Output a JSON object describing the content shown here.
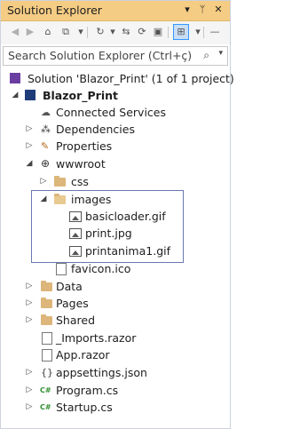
{
  "window": {
    "title": "Solution Explorer",
    "title_icons": [
      "dropdown-arrow-icon",
      "pin-icon",
      "close-icon"
    ]
  },
  "toolbar": {
    "buttons": [
      "back-icon",
      "forward-icon",
      "home-icon",
      "vs-icon",
      "history-icon",
      "sync-icon",
      "refresh-icon",
      "collapse-all-icon",
      "show-all-files-icon",
      "properties-icon",
      "preview-icon"
    ]
  },
  "search": {
    "placeholder": "Search Solution Explorer (Ctrl+ç)"
  },
  "tree": {
    "solution": "Solution 'Blazor_Print' (1 of 1 project)",
    "project": "Blazor_Print",
    "items": [
      {
        "label": "Connected Services",
        "icon": "connected-services-icon"
      },
      {
        "label": "Dependencies",
        "icon": "dependencies-icon"
      },
      {
        "label": "Properties",
        "icon": "properties-icon"
      },
      {
        "label": "wwwroot",
        "icon": "globe-icon"
      },
      {
        "label": "css",
        "icon": "folder-icon"
      },
      {
        "label": "images",
        "icon": "folder-open-icon"
      },
      {
        "label": "basicloader.gif",
        "icon": "image-icon"
      },
      {
        "label": "print.jpg",
        "icon": "image-icon"
      },
      {
        "label": "printanima1.gif",
        "icon": "image-icon"
      },
      {
        "label": "favicon.ico",
        "icon": "file-icon"
      },
      {
        "label": "Data",
        "icon": "folder-icon"
      },
      {
        "label": "Pages",
        "icon": "folder-icon"
      },
      {
        "label": "Shared",
        "icon": "folder-icon"
      },
      {
        "label": "_Imports.razor",
        "icon": "razor-file-icon"
      },
      {
        "label": "App.razor",
        "icon": "razor-file-icon"
      },
      {
        "label": "appsettings.json",
        "icon": "json-file-icon"
      },
      {
        "label": "Program.cs",
        "icon": "csharp-file-icon"
      },
      {
        "label": "Startup.cs",
        "icon": "csharp-file-icon"
      }
    ]
  },
  "colors": {
    "titlebar": "#f5cc84",
    "folder": "#dcb67a",
    "selection_border": "#6a79b0"
  }
}
